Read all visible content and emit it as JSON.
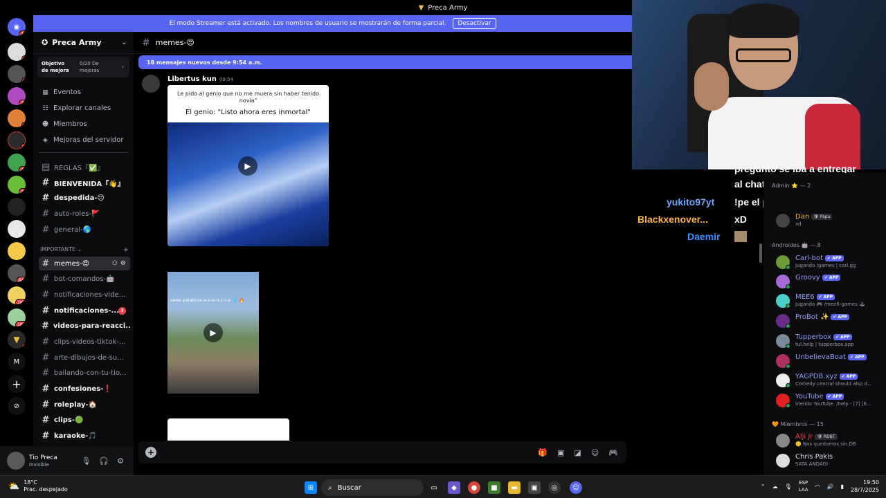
{
  "window": {
    "title": "Preca Army"
  },
  "streamer_banner": {
    "text": "El modo Streamer está activado. Los nombres de usuario se mostrarán de forma parcial.",
    "button": "Desactivar"
  },
  "servers": [
    {
      "badge": "12"
    },
    {
      "badge": "8"
    },
    {
      "badge": "1"
    },
    {
      "badge": "76"
    },
    {
      "badge": "1"
    },
    {
      "badge": "1"
    },
    {
      "badge": "41"
    },
    {
      "badge": "31"
    },
    {
      "badge": ""
    },
    {
      "badge": ""
    },
    {
      "badge": ""
    },
    {
      "badge": "644"
    },
    {
      "badge": "1K+"
    },
    {
      "badge": "1K+"
    },
    {
      "badge": "3"
    }
  ],
  "server_letter": "M",
  "server": {
    "name": "Preca Army"
  },
  "goal": {
    "title": "Objetivo de mejora",
    "progress": "0/20 De mejoras"
  },
  "nav": [
    "Eventos",
    "Explorar canales",
    "Miembros",
    "Mejoras del servidor"
  ],
  "channels_top": [
    {
      "name": "REGLAS『✅』",
      "type": "rules"
    },
    {
      "name": "BIENVENIDA『👋』",
      "unread": true
    },
    {
      "name": "despedida-😔",
      "unread": true
    },
    {
      "name": "auto-roles-🚩",
      "unread": false
    },
    {
      "name": "general-🌎",
      "unread": false
    }
  ],
  "category": {
    "name": "IMPORTANTE"
  },
  "channels_important": [
    {
      "name": "memes-😍",
      "active": true
    },
    {
      "name": "bot-comandos-🤖",
      "unread": false
    },
    {
      "name": "notificaciones-vide...",
      "unread": false
    },
    {
      "name": "notificaciones-...",
      "unread": true,
      "mention": "3"
    },
    {
      "name": "videos-para-reacci...",
      "unread": true
    },
    {
      "name": "clips-videos-tiktok-...",
      "unread": false
    },
    {
      "name": "arte-dibujos-de-su...",
      "unread": false
    },
    {
      "name": "bailando-con-tu-tio...",
      "unread": false
    },
    {
      "name": "confesiones-❗",
      "unread": true
    },
    {
      "name": "roleplay-🏠",
      "unread": true
    },
    {
      "name": "clips-🟢",
      "unread": true
    },
    {
      "name": "karaoke-🎵",
      "unread": true
    }
  ],
  "user": {
    "name": "Tio Preca",
    "status": "Invisible"
  },
  "chat": {
    "channel": "memes-😍",
    "new_messages": "18 mensajes nuevos desde 9:54 a.m."
  },
  "message": {
    "author": "Libertus kun",
    "time": "09:54",
    "media1_caption1": "Le pido al genio que no me muera sin haber tenido novia\"",
    "media1_caption2": "El genio: \"Listo ahora eres inmortal\"",
    "media2_caption": "siete palabras e-s-e-n-c-i-a 💧 🔥"
  },
  "overlay": [
    {
      "user": "",
      "text": "pregunto se iba a entregar"
    },
    {
      "user": "",
      "text": "al chat"
    },
    {
      "user": "yukito97yt",
      "text": "!pe el patriarcado XD",
      "color": "#6fa8ff"
    },
    {
      "user": "Blackxenover...",
      "text": "xD",
      "color": "#ffb347"
    },
    {
      "user": "Daemir",
      "text": "",
      "color": "#3d8bff"
    }
  ],
  "members": {
    "group_admin": "Admin ⭐ — 2",
    "admin_members": [
      {
        "name": "Dan",
        "tag": "🛡 Papu",
        "status": "xd",
        "color": "#f0b232"
      }
    ],
    "group_bots": "Androides 🤖 — 8",
    "bots": [
      {
        "name": "Carl-bot",
        "badge": "✔ APP",
        "status": "Jugando /games | carl.gg"
      },
      {
        "name": "Groovy",
        "badge": "✔ APP",
        "status": ""
      },
      {
        "name": "MEE6",
        "badge": "✔ APP",
        "status": "Jugando 🎮 /mee6-games 🕹"
      },
      {
        "name": "ProBot ✨",
        "badge": "✔ APP",
        "status": ""
      },
      {
        "name": "Tupperbox",
        "badge": "✔ APP",
        "status": "tul.help | tupperbox.app"
      },
      {
        "name": "UnbelievaBoat",
        "badge": "✔ APP",
        "status": ""
      },
      {
        "name": "YAGPDB.xyz",
        "badge": "✔ APP",
        "status": "Comedy central should also d..."
      },
      {
        "name": "YouTube",
        "badge": "✔ APP",
        "status": "Viendo YouTube. /help - [7] [6..."
      }
    ],
    "group_members": "🧡 Miembros — 15",
    "people": [
      {
        "name": "Alji Jr",
        "tag": "🛡 RDBT",
        "status": "🤫 Nos quedamos sin DB",
        "color": "#f23f43"
      },
      {
        "name": "Chris Pakis",
        "tag": "",
        "status": "SATA ANDAGI",
        "color": "#dbdee1"
      }
    ]
  },
  "taskbar": {
    "weather_temp": "18°C",
    "weather_desc": "Prac. despejado",
    "search": "Buscar",
    "lang1": "ESP",
    "lang2": "LAA",
    "time": "19:50",
    "date": "28/7/2025"
  }
}
